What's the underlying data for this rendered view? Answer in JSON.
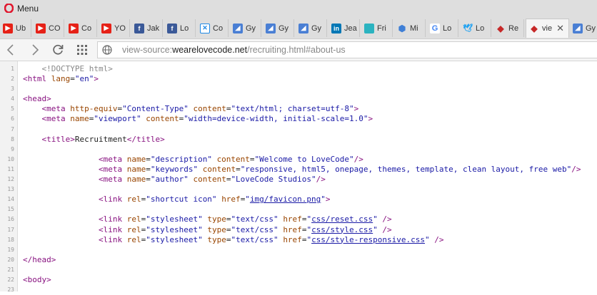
{
  "menu": {
    "label": "Menu"
  },
  "tabs": [
    {
      "title": "Ub",
      "icon": "youtube-icon",
      "color": "#e62117",
      "glyph": "▶"
    },
    {
      "title": "CO",
      "icon": "youtube-icon",
      "color": "#e62117",
      "glyph": "▶"
    },
    {
      "title": "Co",
      "icon": "youtube-icon",
      "color": "#e62117",
      "glyph": "▶"
    },
    {
      "title": "YO",
      "icon": "youtube-icon",
      "color": "#e62117",
      "glyph": "▶"
    },
    {
      "title": "Jak",
      "icon": "facebook-icon",
      "color": "#3b5998",
      "glyph": "f"
    },
    {
      "title": "Lo",
      "icon": "facebook-icon",
      "color": "#3b5998",
      "glyph": "f"
    },
    {
      "title": "Co",
      "icon": "x-icon",
      "color": "#1e88e5",
      "glyph": "✕"
    },
    {
      "title": "Gy",
      "icon": "image-icon",
      "color": "#4a7fd4",
      "glyph": "◢"
    },
    {
      "title": "Gy",
      "icon": "image-icon",
      "color": "#4a7fd4",
      "glyph": "◢"
    },
    {
      "title": "Gy",
      "icon": "image-icon",
      "color": "#4a7fd4",
      "glyph": "◢"
    },
    {
      "title": "Jea",
      "icon": "linkedin-icon",
      "color": "#0077b5",
      "glyph": "in"
    },
    {
      "title": "Fri",
      "icon": "square-icon",
      "color": "#2bb3c0",
      "glyph": ""
    },
    {
      "title": "Mi",
      "icon": "cube-icon",
      "color": "#3f7fd6",
      "glyph": "⬢"
    },
    {
      "title": "Lo",
      "icon": "google-icon",
      "color": "#ffffff",
      "glyph": "G"
    },
    {
      "title": "Lo",
      "icon": "twitter-icon",
      "color": "#1da1f2",
      "glyph": "🕊"
    },
    {
      "title": "Re",
      "icon": "diamond-icon",
      "color": "#2e8b57",
      "glyph": "◆"
    },
    {
      "title": "vie",
      "icon": "diamond-icon",
      "color": "#2e8b57",
      "glyph": "◆",
      "active": true
    },
    {
      "title": "Gy",
      "icon": "image-icon",
      "color": "#4a7fd4",
      "glyph": "◢"
    }
  ],
  "address": {
    "prefix": "view-source:",
    "host": "wearelovecode.net",
    "path": "/recruiting.html#about-us"
  },
  "source_lines": [
    {
      "n": "1",
      "html": "    <span class='cm'>&lt;!DOCTYPE html&gt;</span>"
    },
    {
      "n": "2",
      "html": "<span class='tg'>&lt;html</span> <span class='at'>lang</span>=<span class='av'>\"en\"</span><span class='tg'>&gt;</span>"
    },
    {
      "n": "3",
      "html": ""
    },
    {
      "n": "4",
      "html": "<span class='tg'>&lt;head&gt;</span>"
    },
    {
      "n": "5",
      "html": "    <span class='tg'>&lt;meta</span> <span class='at'>http-equiv</span>=<span class='av'>\"Content-Type\"</span> <span class='at'>content</span>=<span class='av'>\"text/html; charset=utf-8\"</span><span class='tg'>&gt;</span>"
    },
    {
      "n": "6",
      "html": "    <span class='tg'>&lt;meta</span> <span class='at'>name</span>=<span class='av'>\"viewport\"</span> <span class='at'>content</span>=<span class='av'>\"width=device-width, initial-scale=1.0\"</span><span class='tg'>&gt;</span>"
    },
    {
      "n": "7",
      "html": ""
    },
    {
      "n": "8",
      "html": "    <span class='tg'>&lt;title&gt;</span>Recruitment<span class='tg'>&lt;/title&gt;</span>"
    },
    {
      "n": "9",
      "html": ""
    },
    {
      "n": "10",
      "html": "                <span class='tg'>&lt;meta</span> <span class='at'>name</span>=<span class='av'>\"description\"</span> <span class='at'>content</span>=<span class='av'>\"Welcome to LoveCode\"</span><span class='tg'>/&gt;</span>"
    },
    {
      "n": "11",
      "html": "                <span class='tg'>&lt;meta</span> <span class='at'>name</span>=<span class='av'>\"keywords\"</span> <span class='at'>content</span>=<span class='av'>\"responsive, html5, onepage, themes, template, clean layout, free web\"</span><span class='tg'>/&gt;</span>"
    },
    {
      "n": "12",
      "html": "                <span class='tg'>&lt;meta</span> <span class='at'>name</span>=<span class='av'>\"author\"</span> <span class='at'>content</span>=<span class='av'>\"LoveCode Studios\"</span><span class='tg'>/&gt;</span>"
    },
    {
      "n": "13",
      "html": ""
    },
    {
      "n": "14",
      "html": "                <span class='tg'>&lt;link</span> <span class='at'>rel</span>=<span class='av'>\"shortcut icon\"</span> <span class='at'>href</span>=<span class='av'>\"</span><span class='lk'>img/favicon.png</span><span class='av'>\"</span><span class='tg'>&gt;</span>"
    },
    {
      "n": "15",
      "html": ""
    },
    {
      "n": "16",
      "html": "                <span class='tg'>&lt;link</span> <span class='at'>rel</span>=<span class='av'>\"stylesheet\"</span> <span class='at'>type</span>=<span class='av'>\"text/css\"</span> <span class='at'>href</span>=<span class='av'>\"</span><span class='lk'>css/reset.css</span><span class='av'>\"</span> <span class='tg'>/&gt;</span>"
    },
    {
      "n": "17",
      "html": "                <span class='tg'>&lt;link</span> <span class='at'>rel</span>=<span class='av'>\"stylesheet\"</span> <span class='at'>type</span>=<span class='av'>\"text/css\"</span> <span class='at'>href</span>=<span class='av'>\"</span><span class='lk'>css/style.css</span><span class='av'>\"</span> <span class='tg'>/&gt;</span>"
    },
    {
      "n": "18",
      "html": "                <span class='tg'>&lt;link</span> <span class='at'>rel</span>=<span class='av'>\"stylesheet\"</span> <span class='at'>type</span>=<span class='av'>\"text/css\"</span> <span class='at'>href</span>=<span class='av'>\"</span><span class='lk'>css/style-responsive.css</span><span class='av'>\"</span> <span class='tg'>/&gt;</span>"
    },
    {
      "n": "19",
      "html": ""
    },
    {
      "n": "20",
      "html": "<span class='tg'>&lt;/head&gt;</span>"
    },
    {
      "n": "21",
      "html": ""
    },
    {
      "n": "22",
      "html": "<span class='tg'>&lt;body&gt;</span>"
    },
    {
      "n": "23",
      "html": ""
    }
  ]
}
